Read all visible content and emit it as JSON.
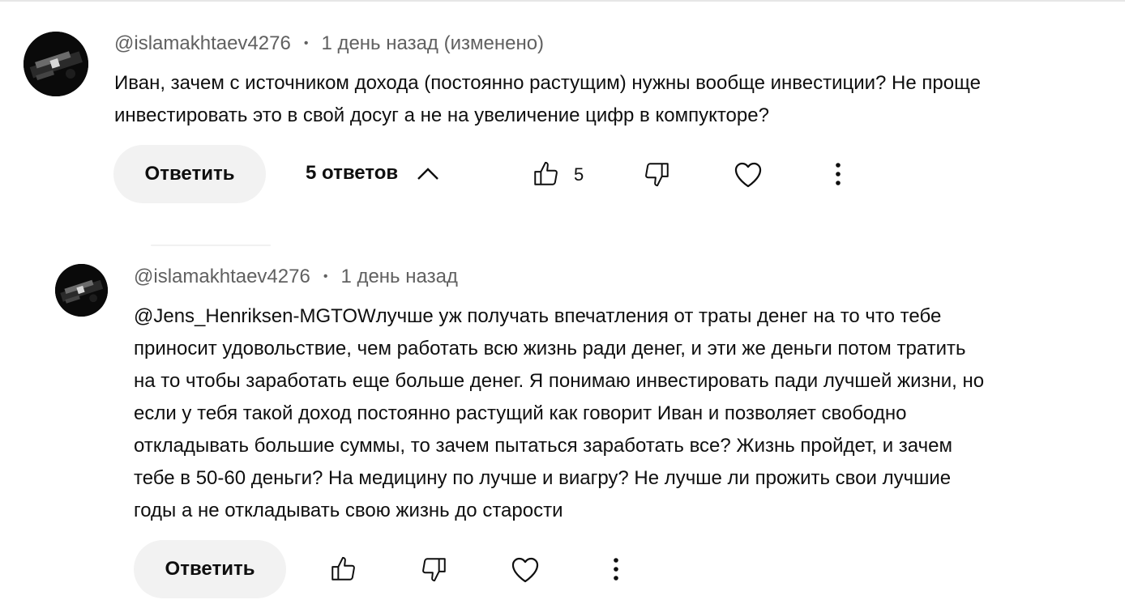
{
  "comment": {
    "author": "@islamakhtaev4276",
    "separator": "•",
    "time": "1 день назад (изменено)",
    "text_lines": [
      "Иван, зачем  с источником дохода (постоянно растущим) нужны вообще инвестиции? Не проще",
      "инвестировать это в свой досуг а не на увеличение цифр в компукторе?"
    ],
    "reply_label": "Ответить",
    "replies_label": "5 ответов",
    "like_count": "5",
    "icons": {
      "like": "thumbs-up-icon",
      "dislike": "thumbs-down-icon",
      "heart": "heart-icon",
      "more": "more-vert-icon",
      "collapse": "chevron-up-icon"
    }
  },
  "reply": {
    "author": "@islamakhtaev4276",
    "separator": "•",
    "time": "1 день назад",
    "text_lines": [
      "@Jens_Henriksen-MGTOWлучше уж получать впечатления от траты денег на то что тебе",
      "приносит удовольствие, чем работать всю жизнь ради денег, и эти же деньги потом тратить",
      "на то чтобы заработать еще больше денег. Я понимаю инвестировать пади лучшей жизни, но",
      "если у тебя такой доход постоянно растущий как говорит Иван и позволяет свободно",
      "откладывать большие суммы, то зачем пытаться заработать все? Жизнь пройдет, и зачем",
      "тебе в 50-60 деньги? На медицину по лучше и виагру? Не лучше ли прожить свои лучшие",
      "годы а не откладывать свою жизнь до старости"
    ],
    "reply_label": "Ответить",
    "icons": {
      "like": "thumbs-up-icon",
      "dislike": "thumbs-down-icon",
      "heart": "heart-icon",
      "more": "more-vert-icon"
    }
  }
}
